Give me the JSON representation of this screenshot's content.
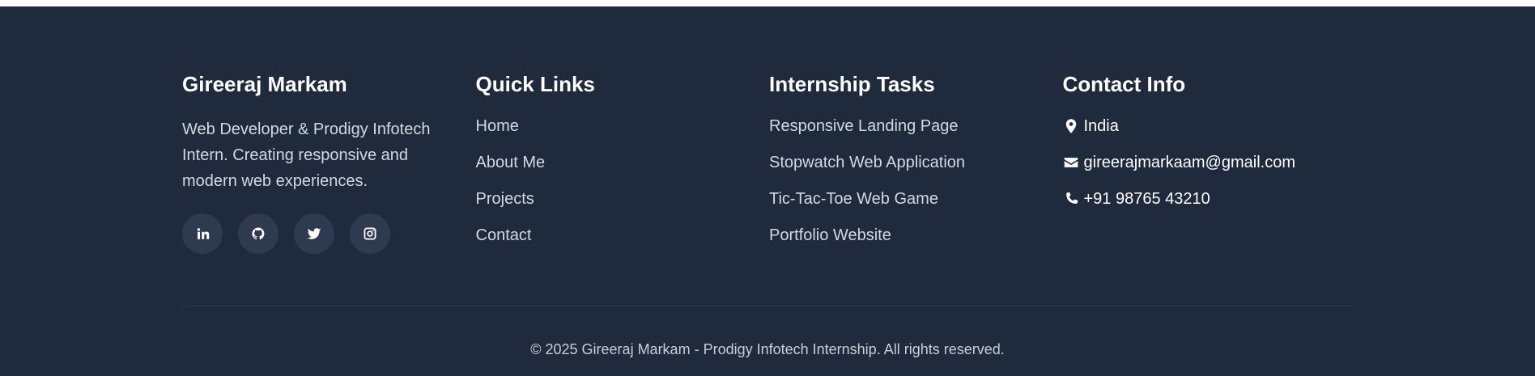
{
  "about": {
    "name": "Gireeraj Markam",
    "description": "Web Developer & Prodigy Infotech Intern. Creating responsive and modern web experiences.",
    "socials": [
      {
        "icon": "linkedin-icon"
      },
      {
        "icon": "github-icon"
      },
      {
        "icon": "twitter-icon"
      },
      {
        "icon": "instagram-icon"
      }
    ]
  },
  "quick_links": {
    "title": "Quick Links",
    "items": [
      "Home",
      "About Me",
      "Projects",
      "Contact"
    ]
  },
  "tasks": {
    "title": "Internship Tasks",
    "items": [
      "Responsive Landing Page",
      "Stopwatch Web Application",
      "Tic-Tac-Toe Web Game",
      "Portfolio Website"
    ]
  },
  "contact": {
    "title": "Contact Info",
    "location": "India",
    "email": "gireerajmarkaam@gmail.com",
    "phone": "+91 98765 43210"
  },
  "copyright": "© 2025 Gireeraj Markam - Prodigy Infotech Internship. All rights reserved.",
  "colors": {
    "footer_bg": "#1f2a3d",
    "social_bg": "#2e3a4f",
    "text_muted": "#d3d8e0"
  }
}
